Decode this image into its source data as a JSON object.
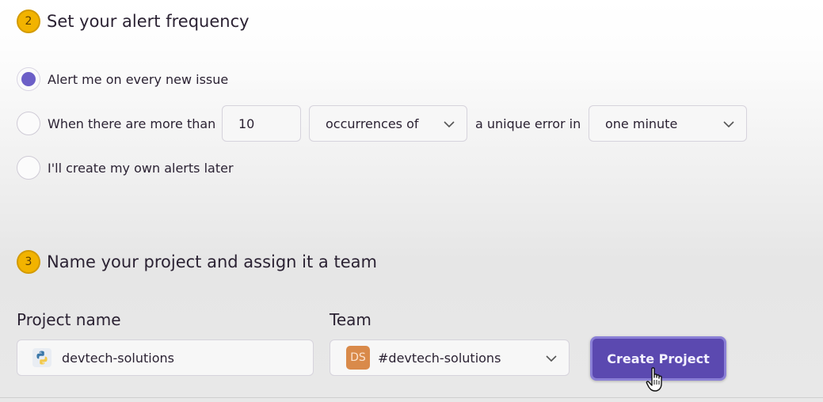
{
  "step2": {
    "number": "2",
    "title": "Set your alert frequency"
  },
  "alert_options": [
    {
      "label": "Alert me on every new issue",
      "selected": true
    },
    {
      "label": "When there are more than",
      "selected": false
    },
    {
      "label": "I'll create my own alerts later",
      "selected": false
    }
  ],
  "threshold": {
    "count_value": "10",
    "occurrence_select": "occurrences of",
    "middle_text": "a unique error in",
    "interval_select": "one minute"
  },
  "step3": {
    "number": "3",
    "title": "Name your project and assign it a team"
  },
  "project": {
    "name_label": "Project name",
    "name_value": "devtech-solutions",
    "platform_icon": "python-icon"
  },
  "team": {
    "label": "Team",
    "avatar_initials": "DS",
    "value": "#devtech-solutions"
  },
  "create_button": "Create Project",
  "colors": {
    "accent": "#6c5fc7",
    "button": "#5b49b0",
    "badge": "#f2b300",
    "team_avatar": "#d98a4a"
  }
}
